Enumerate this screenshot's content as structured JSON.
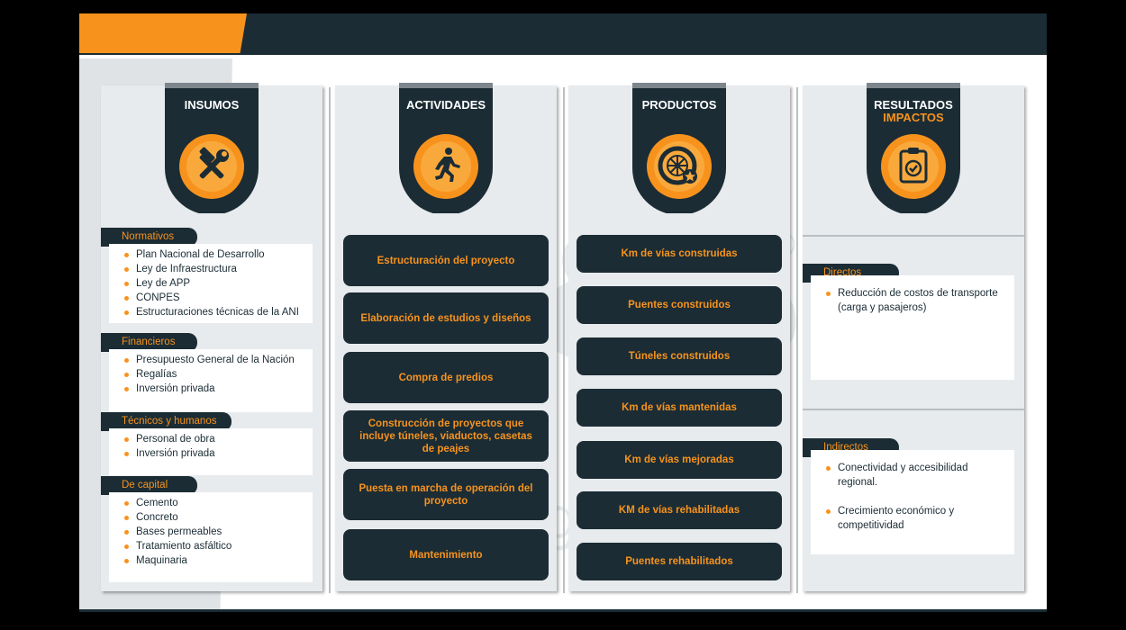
{
  "columns": {
    "insumos": {
      "title": "INSUMOS",
      "categories": [
        {
          "label": "Normativos",
          "items": [
            "Plan Nacional de Desarrollo",
            "Ley de Infraestructura",
            "Ley de APP",
            "CONPES",
            "Estructuraciones técnicas de la ANI"
          ]
        },
        {
          "label": "Financieros",
          "items": [
            "Presupuesto General de la Nación",
            "Regalías",
            "Inversión privada"
          ]
        },
        {
          "label": "Técnicos y humanos",
          "items": [
            "Personal de obra",
            "Inversión privada"
          ]
        },
        {
          "label": "De capital",
          "items": [
            "Cemento",
            "Concreto",
            "Bases permeables",
            "Tratamiento asfáltico",
            "Maquinaria"
          ]
        }
      ]
    },
    "actividades": {
      "title": "ACTIVIDADES",
      "items": [
        "Estructuración del proyecto",
        "Elaboración de estudios y diseños",
        "Compra de predios",
        "Construcción de proyectos que incluye túneles, viaductos, casetas de peajes",
        "Puesta en marcha de operación del proyecto",
        "Mantenimiento"
      ]
    },
    "productos": {
      "title": "PRODUCTOS",
      "items": [
        "Km de vías construidas",
        "Puentes construidos",
        "Túneles construidos",
        "Km de vías mantenidas",
        "Km de vías mejoradas",
        "KM de vías rehabilitadas",
        "Puentes rehabilitados"
      ]
    },
    "resultados": {
      "title": "RESULTADOS",
      "title2": "IMPACTOS",
      "directos": {
        "label": "Directos",
        "items": [
          "Reducción de costos de transporte (carga y pasajeros)"
        ]
      },
      "indirectos": {
        "label": "Indirectos",
        "items": [
          "Conectividad y accesibilidad regional.",
          "Crecimiento económico y competitividad"
        ]
      }
    }
  },
  "watermark": {
    "main": "M&S",
    "registered": "®",
    "sub": "Holding Group"
  },
  "colors": {
    "dark": "#1b2c35",
    "accent": "#f7931d",
    "panel": "#e8ebed"
  },
  "icons": {
    "insumos": "tools-icon",
    "actividades": "running-man-icon",
    "productos": "wheel-icon",
    "resultados": "clipboard-check-icon"
  }
}
